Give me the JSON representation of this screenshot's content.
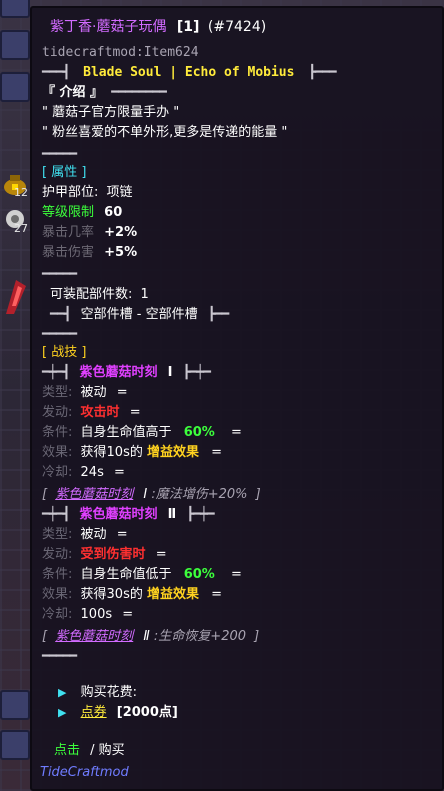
{
  "background": {
    "slot_counts": [
      "12",
      "27"
    ]
  },
  "tooltip": {
    "title": "紫丁香·蘑菇子玩偶",
    "count": "[1]",
    "item_number": "(#7424)",
    "item_id": "tidecraftmod:Item624",
    "header_left_deco": "━━━┫",
    "header_text": "Blade Soul | Echo of Mobius",
    "header_right_deco": "┣━━━",
    "intro_title": "『 介绍 』",
    "intro_deco": "━━━━━━━━",
    "intro_lines": [
      "\" 蘑菇子官方限量手办 \"",
      "\" 粉丝喜爱的不单外形,更多是传递的能量 \""
    ],
    "short_rule": "━━━━━",
    "attributes": {
      "title": "[ 属性 ]",
      "slot_label": "护甲部位:",
      "slot_value": "项链",
      "level_label": "等级限制",
      "level_value": "60",
      "crit_rate_label": "暴击几率",
      "crit_rate_value": "+2%",
      "crit_dmg_label": "暴击伤害",
      "crit_dmg_value": "+5%"
    },
    "parts": {
      "count_label": "可装配部件数:",
      "count_value": "1",
      "slot_deco_left": "━━┫",
      "slot_text": "空部件槽 - 空部件槽",
      "slot_deco_right": "┣━━"
    },
    "skills_title": "[ 战技 ]",
    "skills": [
      {
        "deco_left": "━┿━┫",
        "name": "紫色蘑菇时刻",
        "roman": "Ⅰ",
        "deco_right": "┣━┿━",
        "type_label": "类型:",
        "type_value": "被动",
        "trigger_label": "发动:",
        "trigger_value": "攻击时",
        "cond_label": "条件:",
        "cond_prefix": "自身生命值高于",
        "cond_value": "60%",
        "effect_label": "效果:",
        "effect_prefix": "获得10s的",
        "effect_value": "增益效果",
        "cd_label": "冷却:",
        "cd_value": "24s",
        "summary_open": "[",
        "summary_name": "紫色蘑菇时刻",
        "summary_roman": "Ⅰ",
        "summary_desc": ":魔法增伤+20%",
        "summary_close": "]"
      },
      {
        "deco_left": "━┿━┫",
        "name": "紫色蘑菇时刻",
        "roman": "Ⅱ",
        "deco_right": "┣━┿━",
        "type_label": "类型:",
        "type_value": "被动",
        "trigger_label": "发动:",
        "trigger_value": "受到伤害时",
        "cond_label": "条件:",
        "cond_prefix": "自身生命值低于",
        "cond_value": "60%",
        "effect_label": "效果:",
        "effect_prefix": "获得30s的",
        "effect_value": "增益效果",
        "cd_label": "冷却:",
        "cd_value": "100s",
        "summary_open": "[",
        "summary_name": "紫色蘑菇时刻",
        "summary_roman": "Ⅱ",
        "summary_desc": ":生命恢复+200",
        "summary_close": "]"
      }
    ],
    "eq": "=",
    "purchase": {
      "cost_label": "购买花费:",
      "currency_name": "点券",
      "currency_amount": "[2000点]"
    },
    "action": {
      "click_text": "点击",
      "buy_text": "/ 购买"
    },
    "mod_name": "TideCraftmod"
  },
  "colors": {
    "title_purple": "#d26bff",
    "gold": "#ffd21f",
    "cyan": "#40e0f0",
    "green": "#3cff3c",
    "red": "#ff3030",
    "magenta_skill": "#e040ff"
  }
}
